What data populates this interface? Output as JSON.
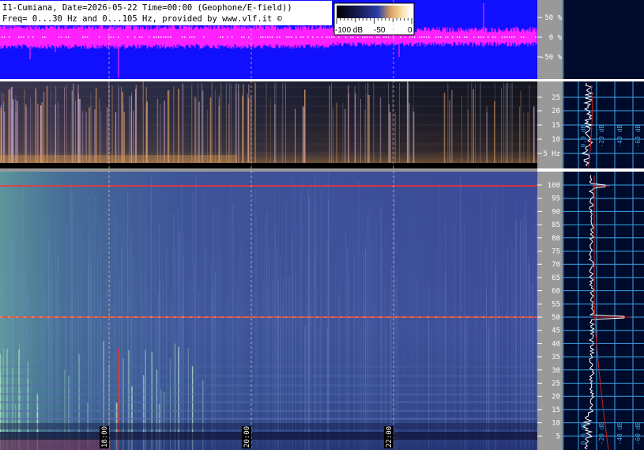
{
  "header": {
    "line1": "I1-Cumiana, Date=2026-05-22 Time=00:00 (Geophone/E-field))",
    "line2": "Freq= 0...30 Hz and 0...105 Hz, provided by www.vlf.it ©"
  },
  "colorbar": {
    "labels": [
      "-100 dB",
      "-50",
      "0"
    ]
  },
  "amplitude_axis": {
    "labels": [
      "50 %",
      "0 %",
      "-50 %"
    ]
  },
  "upper_axis": {
    "labels": [
      "25",
      "20",
      "15",
      "10",
      "5 Hz"
    ]
  },
  "lower_axis": {
    "labels": [
      "100",
      "95",
      "90",
      "85",
      "80",
      "75",
      "70",
      "65",
      "60",
      "55",
      "50",
      "45",
      "40",
      "35",
      "30",
      "25",
      "20",
      "15",
      "10",
      "5"
    ]
  },
  "time_axis": {
    "labels": [
      "18:00",
      "20:00",
      "22:00"
    ]
  },
  "spectrum_upper": {
    "labels": [
      "0.0 dB",
      "-20 dB",
      "-40 dB",
      "-60 dB"
    ]
  },
  "spectrum_lower": {
    "labels": [
      "0.0 dB",
      "-20 dB",
      "-40 dB",
      "-60 dB"
    ]
  },
  "colors": {
    "amplitude_bg": "#1010ff",
    "amplitude_trace": "#ff22ff",
    "spectrogram_lower": "#3a4794",
    "spectrogram_upper": "#1a1c2a",
    "axis_panel": "#999999",
    "spectrum_bg": "#000a2a",
    "grid": "#3aa6e8",
    "marker": "#ffffff"
  }
}
